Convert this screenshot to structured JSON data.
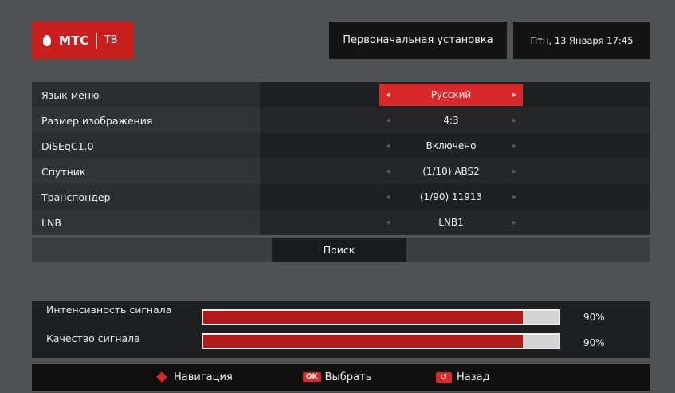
{
  "header": {
    "brand": "МТС",
    "brand_suffix": "ТВ",
    "title": "Первоначальная установка",
    "datetime": "Птн, 13 Января 17:45"
  },
  "menu": {
    "rows": [
      {
        "label": "Язык меню",
        "value": "Русский",
        "active": true
      },
      {
        "label": "Размер изображения",
        "value": "4:3",
        "active": false
      },
      {
        "label": "DiSEqC1.0",
        "value": "Включено",
        "active": false
      },
      {
        "label": "Спутник",
        "value": "(1/10) ABS2",
        "active": false
      },
      {
        "label": "Транспондер",
        "value": "(1/90) 11913",
        "active": false
      },
      {
        "label": "LNB",
        "value": "LNB1",
        "active": false
      }
    ],
    "search_label": "Поиск"
  },
  "signal": {
    "intensity_label": "Интенсивность сигнала",
    "intensity_value": 0.9,
    "intensity_text": "90%",
    "quality_label": "Качество сигнала",
    "quality_value": 0.9,
    "quality_text": "90%"
  },
  "footer": {
    "nav_label": "Навигация",
    "ok_badge": "OK",
    "ok_label": "Выбрать",
    "back_label": "Назад"
  },
  "colors": {
    "accent": "#d9282a",
    "bar_fill": "#b01c1c",
    "background": "#505255"
  },
  "icons": {
    "nav": "dpad-icon",
    "ok": "ok-button-icon",
    "back": "back-arrow-icon",
    "logo": "mts-egg-icon"
  }
}
